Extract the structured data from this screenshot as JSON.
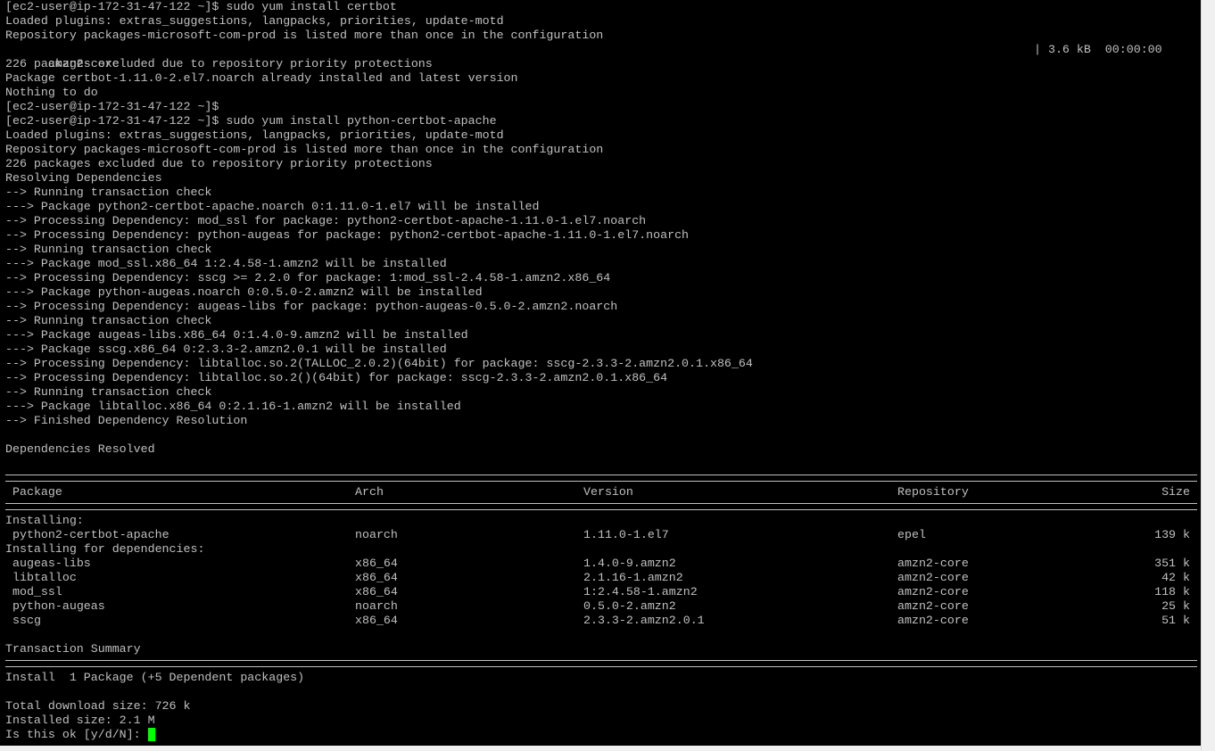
{
  "terminal": {
    "lines": [
      "[ec2-user@ip-172-31-47-122 ~]$ sudo yum install certbot",
      "Loaded plugins: extras_suggestions, langpacks, priorities, update-motd",
      "Repository packages-microsoft-com-prod is listed more than once in the configuration",
      "amzn2-core",
      "226 packages excluded due to repository priority protections",
      "Package certbot-1.11.0-2.el7.noarch already installed and latest version",
      "Nothing to do",
      "[ec2-user@ip-172-31-47-122 ~]$",
      "[ec2-user@ip-172-31-47-122 ~]$ sudo yum install python-certbot-apache",
      "Loaded plugins: extras_suggestions, langpacks, priorities, update-motd",
      "Repository packages-microsoft-com-prod is listed more than once in the configuration",
      "226 packages excluded due to repository priority protections",
      "Resolving Dependencies",
      "--> Running transaction check",
      "---> Package python2-certbot-apache.noarch 0:1.11.0-1.el7 will be installed",
      "--> Processing Dependency: mod_ssl for package: python2-certbot-apache-1.11.0-1.el7.noarch",
      "--> Processing Dependency: python-augeas for package: python2-certbot-apache-1.11.0-1.el7.noarch",
      "--> Running transaction check",
      "---> Package mod_ssl.x86_64 1:2.4.58-1.amzn2 will be installed",
      "--> Processing Dependency: sscg >= 2.2.0 for package: 1:mod_ssl-2.4.58-1.amzn2.x86_64",
      "---> Package python-augeas.noarch 0:0.5.0-2.amzn2 will be installed",
      "--> Processing Dependency: augeas-libs for package: python-augeas-0.5.0-2.amzn2.noarch",
      "--> Running transaction check",
      "---> Package augeas-libs.x86_64 0:1.4.0-9.amzn2 will be installed",
      "---> Package sscg.x86_64 0:2.3.3-2.amzn2.0.1 will be installed",
      "--> Processing Dependency: libtalloc.so.2(TALLOC_2.0.2)(64bit) for package: sscg-2.3.3-2.amzn2.0.1.x86_64",
      "--> Processing Dependency: libtalloc.so.2()(64bit) for package: sscg-2.3.3-2.amzn2.0.1.x86_64",
      "--> Running transaction check",
      "---> Package libtalloc.x86_64 0:2.1.16-1.amzn2 will be installed",
      "--> Finished Dependency Resolution",
      "",
      "Dependencies Resolved"
    ],
    "download_progress": "| 3.6 kB  00:00:00"
  },
  "table": {
    "headers": [
      "Package",
      "Arch",
      "Version",
      "Repository",
      "Size"
    ],
    "installing_label": "Installing:",
    "installing_rows": [
      [
        "python2-certbot-apache",
        "noarch",
        "1.11.0-1.el7",
        "epel",
        "139 k"
      ]
    ],
    "deps_label": "Installing for dependencies:",
    "dependency_rows": [
      [
        "augeas-libs",
        "x86_64",
        "1.4.0-9.amzn2",
        "amzn2-core",
        "351 k"
      ],
      [
        "libtalloc",
        "x86_64",
        "2.1.16-1.amzn2",
        "amzn2-core",
        "42 k"
      ],
      [
        "mod_ssl",
        "x86_64",
        "1:2.4.58-1.amzn2",
        "amzn2-core",
        "118 k"
      ],
      [
        "python-augeas",
        "noarch",
        "0.5.0-2.amzn2",
        "amzn2-core",
        "25 k"
      ],
      [
        "sscg",
        "x86_64",
        "2.3.3-2.amzn2.0.1",
        "amzn2-core",
        "51 k"
      ]
    ]
  },
  "summary": {
    "title": "Transaction Summary",
    "install_line": "Install  1 Package (+5 Dependent packages)",
    "download_size": "Total download size: 726 k",
    "installed_size": "Installed size: 2.1 M",
    "prompt": "Is this ok [y/d/N]: "
  },
  "colors": {
    "background": "#000000",
    "foreground": "#c0c0c0",
    "cursor": "#00ff00"
  }
}
